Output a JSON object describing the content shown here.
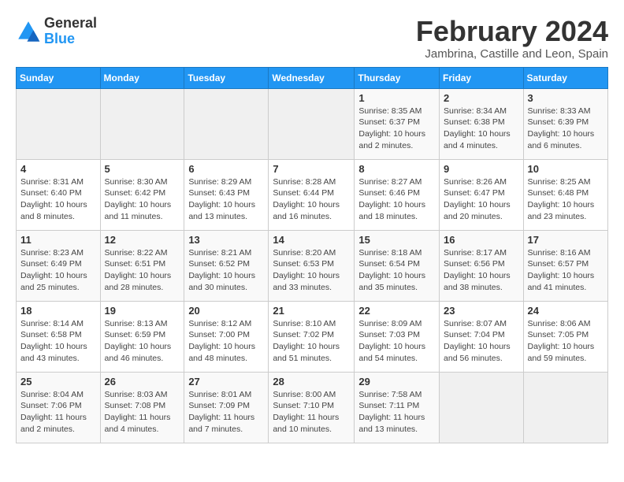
{
  "logo": {
    "line1": "General",
    "line2": "Blue"
  },
  "title": "February 2024",
  "location": "Jambrina, Castille and Leon, Spain",
  "days_header": [
    "Sunday",
    "Monday",
    "Tuesday",
    "Wednesday",
    "Thursday",
    "Friday",
    "Saturday"
  ],
  "weeks": [
    [
      {
        "day": "",
        "info": ""
      },
      {
        "day": "",
        "info": ""
      },
      {
        "day": "",
        "info": ""
      },
      {
        "day": "",
        "info": ""
      },
      {
        "day": "1",
        "info": "Sunrise: 8:35 AM\nSunset: 6:37 PM\nDaylight: 10 hours and 2 minutes."
      },
      {
        "day": "2",
        "info": "Sunrise: 8:34 AM\nSunset: 6:38 PM\nDaylight: 10 hours and 4 minutes."
      },
      {
        "day": "3",
        "info": "Sunrise: 8:33 AM\nSunset: 6:39 PM\nDaylight: 10 hours and 6 minutes."
      }
    ],
    [
      {
        "day": "4",
        "info": "Sunrise: 8:31 AM\nSunset: 6:40 PM\nDaylight: 10 hours and 8 minutes."
      },
      {
        "day": "5",
        "info": "Sunrise: 8:30 AM\nSunset: 6:42 PM\nDaylight: 10 hours and 11 minutes."
      },
      {
        "day": "6",
        "info": "Sunrise: 8:29 AM\nSunset: 6:43 PM\nDaylight: 10 hours and 13 minutes."
      },
      {
        "day": "7",
        "info": "Sunrise: 8:28 AM\nSunset: 6:44 PM\nDaylight: 10 hours and 16 minutes."
      },
      {
        "day": "8",
        "info": "Sunrise: 8:27 AM\nSunset: 6:46 PM\nDaylight: 10 hours and 18 minutes."
      },
      {
        "day": "9",
        "info": "Sunrise: 8:26 AM\nSunset: 6:47 PM\nDaylight: 10 hours and 20 minutes."
      },
      {
        "day": "10",
        "info": "Sunrise: 8:25 AM\nSunset: 6:48 PM\nDaylight: 10 hours and 23 minutes."
      }
    ],
    [
      {
        "day": "11",
        "info": "Sunrise: 8:23 AM\nSunset: 6:49 PM\nDaylight: 10 hours and 25 minutes."
      },
      {
        "day": "12",
        "info": "Sunrise: 8:22 AM\nSunset: 6:51 PM\nDaylight: 10 hours and 28 minutes."
      },
      {
        "day": "13",
        "info": "Sunrise: 8:21 AM\nSunset: 6:52 PM\nDaylight: 10 hours and 30 minutes."
      },
      {
        "day": "14",
        "info": "Sunrise: 8:20 AM\nSunset: 6:53 PM\nDaylight: 10 hours and 33 minutes."
      },
      {
        "day": "15",
        "info": "Sunrise: 8:18 AM\nSunset: 6:54 PM\nDaylight: 10 hours and 35 minutes."
      },
      {
        "day": "16",
        "info": "Sunrise: 8:17 AM\nSunset: 6:56 PM\nDaylight: 10 hours and 38 minutes."
      },
      {
        "day": "17",
        "info": "Sunrise: 8:16 AM\nSunset: 6:57 PM\nDaylight: 10 hours and 41 minutes."
      }
    ],
    [
      {
        "day": "18",
        "info": "Sunrise: 8:14 AM\nSunset: 6:58 PM\nDaylight: 10 hours and 43 minutes."
      },
      {
        "day": "19",
        "info": "Sunrise: 8:13 AM\nSunset: 6:59 PM\nDaylight: 10 hours and 46 minutes."
      },
      {
        "day": "20",
        "info": "Sunrise: 8:12 AM\nSunset: 7:00 PM\nDaylight: 10 hours and 48 minutes."
      },
      {
        "day": "21",
        "info": "Sunrise: 8:10 AM\nSunset: 7:02 PM\nDaylight: 10 hours and 51 minutes."
      },
      {
        "day": "22",
        "info": "Sunrise: 8:09 AM\nSunset: 7:03 PM\nDaylight: 10 hours and 54 minutes."
      },
      {
        "day": "23",
        "info": "Sunrise: 8:07 AM\nSunset: 7:04 PM\nDaylight: 10 hours and 56 minutes."
      },
      {
        "day": "24",
        "info": "Sunrise: 8:06 AM\nSunset: 7:05 PM\nDaylight: 10 hours and 59 minutes."
      }
    ],
    [
      {
        "day": "25",
        "info": "Sunrise: 8:04 AM\nSunset: 7:06 PM\nDaylight: 11 hours and 2 minutes."
      },
      {
        "day": "26",
        "info": "Sunrise: 8:03 AM\nSunset: 7:08 PM\nDaylight: 11 hours and 4 minutes."
      },
      {
        "day": "27",
        "info": "Sunrise: 8:01 AM\nSunset: 7:09 PM\nDaylight: 11 hours and 7 minutes."
      },
      {
        "day": "28",
        "info": "Sunrise: 8:00 AM\nSunset: 7:10 PM\nDaylight: 11 hours and 10 minutes."
      },
      {
        "day": "29",
        "info": "Sunrise: 7:58 AM\nSunset: 7:11 PM\nDaylight: 11 hours and 13 minutes."
      },
      {
        "day": "",
        "info": ""
      },
      {
        "day": "",
        "info": ""
      }
    ]
  ]
}
